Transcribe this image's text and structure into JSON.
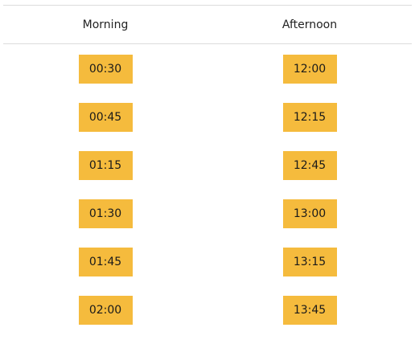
{
  "headers": {
    "morning": "Morning",
    "afternoon": "Afternoon"
  },
  "slot_color": "#f5bb3d",
  "morning_slots": [
    "00:30",
    "00:45",
    "01:15",
    "01:30",
    "01:45",
    "02:00"
  ],
  "afternoon_slots": [
    "12:00",
    "12:15",
    "12:45",
    "13:00",
    "13:15",
    "13:45"
  ]
}
